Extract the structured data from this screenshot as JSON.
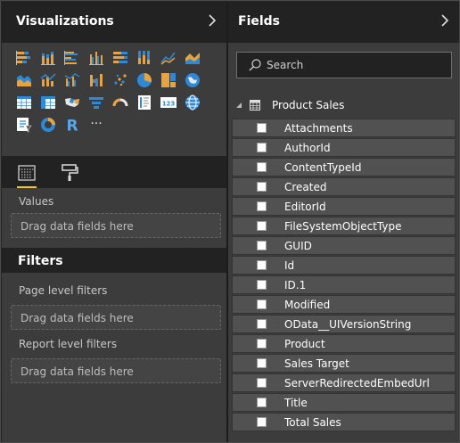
{
  "visualizations": {
    "title": "Visualizations",
    "rows": [
      [
        "stacked-bar-icon",
        "stacked-column-icon",
        "clustered-bar-icon",
        "clustered-column-icon",
        "100-stacked-bar-icon",
        "100-stacked-column-icon",
        "line-chart-icon",
        "area-chart-icon"
      ],
      [
        "stacked-area-icon",
        "line-and-stacked-column-icon",
        "line-and-clustered-column-icon",
        "ribbon-chart-icon",
        "scatter-chart-icon",
        "pie-chart-icon",
        "treemap-icon",
        "map-icon"
      ],
      [
        "table-icon",
        "matrix-icon",
        "filled-map-icon",
        "funnel-icon",
        "gauge-icon",
        "multi-row-card-icon",
        "card-icon",
        "globe-icon"
      ],
      [
        "slicer-icon",
        "donut-chart-icon",
        "r-visual-icon",
        "more-icon"
      ]
    ],
    "r_label": "R",
    "more_label": "···",
    "card_label": "123",
    "values_label": "Values",
    "values_drop": "Drag data fields here"
  },
  "filters": {
    "title": "Filters",
    "page_label": "Page level filters",
    "page_drop": "Drag data fields here",
    "report_label": "Report level filters",
    "report_drop": "Drag data fields here"
  },
  "fields": {
    "title": "Fields",
    "search_placeholder": "Search",
    "table_name": "Product Sales",
    "items": [
      "Attachments",
      "AuthorId",
      "ContentTypeId",
      "Created",
      "EditorId",
      "FileSystemObjectType",
      "GUID",
      "Id",
      "ID.1",
      "Modified",
      "OData__UIVersionString",
      "Product",
      "Sales Target",
      "ServerRedirectedEmbedUrl",
      "Title",
      "Total Sales"
    ]
  },
  "colors": {
    "accent": "#f2c811",
    "viz_orange": "#e8a33d",
    "viz_blue": "#2d8ad8",
    "background": "#3c3c3c",
    "header": "#222222"
  }
}
